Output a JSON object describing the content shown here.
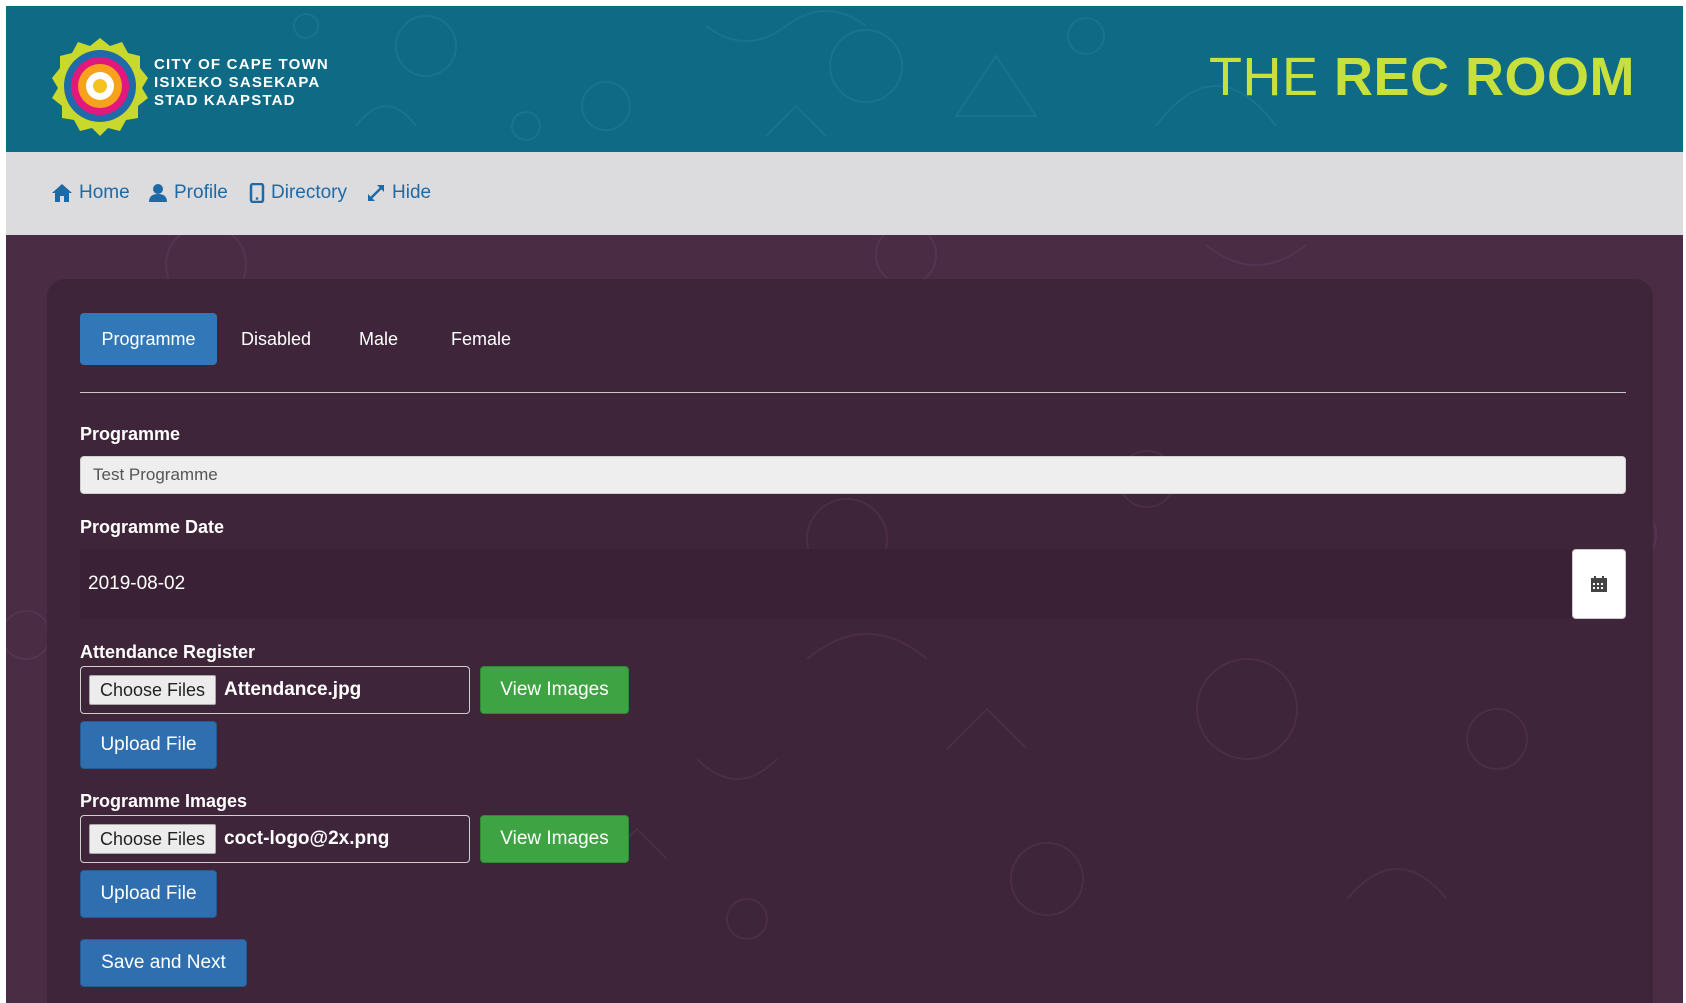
{
  "brand": {
    "org_line1": "CITY OF CAPE TOWN",
    "org_line2": "ISIXEKO SASEKAPA",
    "org_line3": "STAD KAAPSTAD",
    "title_pre": "THE ",
    "title_main": "REC ROOM",
    "accent_color": "#c8e03c",
    "header_color": "#0f6a86"
  },
  "nav": {
    "items": [
      {
        "label": "Home",
        "icon": "home-icon"
      },
      {
        "label": "Profile",
        "icon": "user-icon"
      },
      {
        "label": "Directory",
        "icon": "tablet-icon"
      },
      {
        "label": "Hide",
        "icon": "expand-arrows-icon"
      }
    ]
  },
  "tabs": [
    {
      "label": "Programme",
      "active": true
    },
    {
      "label": "Disabled",
      "active": false
    },
    {
      "label": "Male",
      "active": false
    },
    {
      "label": "Female",
      "active": false
    }
  ],
  "form": {
    "programme_label": "Programme",
    "programme_value": "Test Programme",
    "date_label": "Programme Date",
    "date_value": "2019-08-02",
    "attendance_label": "Attendance Register",
    "attendance_choose": "Choose Files",
    "attendance_file": "Attendance.jpg",
    "attendance_view": "View Images",
    "attendance_upload": "Upload File",
    "images_label": "Programme Images",
    "images_choose": "Choose Files",
    "images_file": "coct-logo@2x.png",
    "images_view": "View Images",
    "images_upload": "Upload File",
    "save_next": "Save and Next"
  }
}
